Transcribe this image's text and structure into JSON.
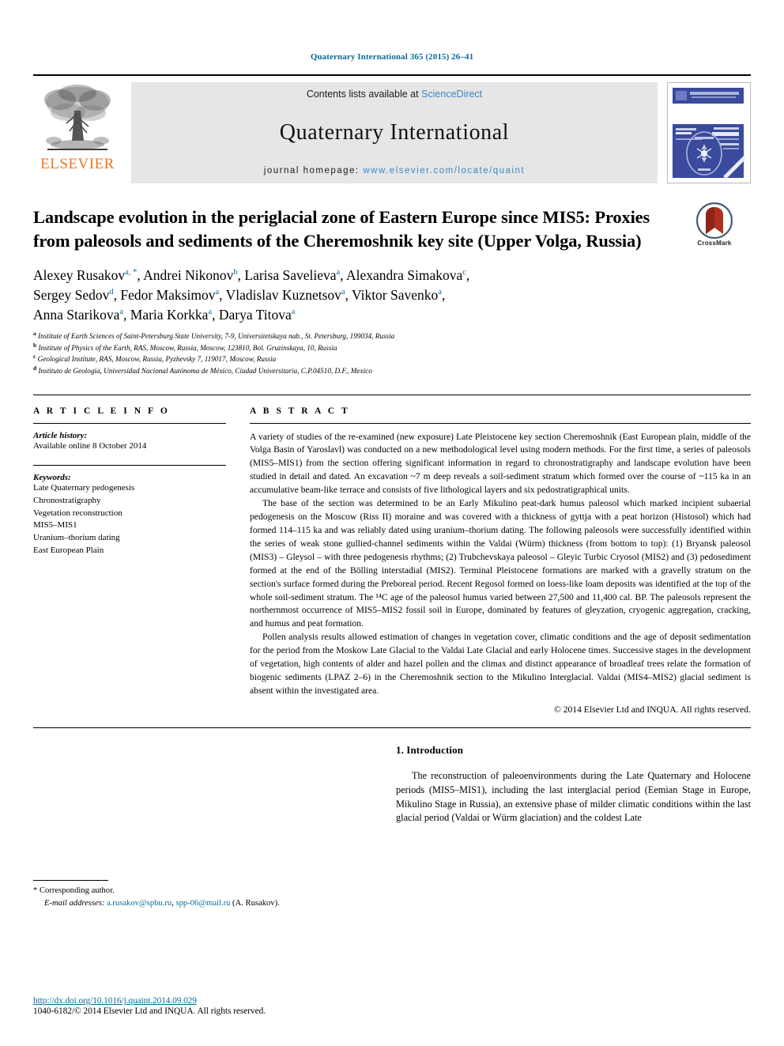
{
  "running_head": "Quaternary International 365 (2015) 26–41",
  "masthead": {
    "publisher_name": "ELSEVIER",
    "contents_prefix": "Contents lists available at ",
    "contents_link": "ScienceDirect",
    "journal_title": "Quaternary International",
    "homepage_prefix": "journal homepage: ",
    "homepage_url": "www.elsevier.com/locate/quaint",
    "cover_banner": "QUATERNARY INTERNATIONAL",
    "cover_subbanner": "The Journal of the International Union for Quaternary Research"
  },
  "article": {
    "title": "Landscape evolution in the periglacial zone of Eastern Europe since MIS5: Proxies from paleosols and sediments of the Cheremoshnik key site (Upper Volga, Russia)",
    "crossmark_label": "CrossMark",
    "authors_line_1": "Alexey Rusakov",
    "authors": [
      {
        "name": "Alexey Rusakov",
        "sup": "a, *"
      },
      {
        "name": "Andrei Nikonov",
        "sup": "b"
      },
      {
        "name": "Larisa Savelieva",
        "sup": "a"
      },
      {
        "name": "Alexandra Simakova",
        "sup": "c"
      },
      {
        "name": "Sergey Sedov",
        "sup": "d"
      },
      {
        "name": "Fedor Maksimov",
        "sup": "a"
      },
      {
        "name": "Vladislav Kuznetsov",
        "sup": "a"
      },
      {
        "name": "Viktor Savenko",
        "sup": "a"
      },
      {
        "name": "Anna Starikova",
        "sup": "a"
      },
      {
        "name": "Maria Korkka",
        "sup": "a"
      },
      {
        "name": "Darya Titova",
        "sup": "a"
      }
    ],
    "affiliations": [
      {
        "sup": "a",
        "text": "Institute of Earth Sciences of Saint-Petersburg State University, 7-9, Universitetskaya nab., St. Petersburg, 199034, Russia"
      },
      {
        "sup": "b",
        "text": "Institute of Physics of the Earth, RAS, Moscow, Russia, Moscow, 123810, Bol. Gruzinskaya, 10, Russia"
      },
      {
        "sup": "c",
        "text": "Geological Institute, RAS, Moscow, Russia, Pyzhevsky 7, 119017, Moscow, Russia"
      },
      {
        "sup": "d",
        "text": "Instituto de Geología, Universidad Nacional Autónoma de México, Ciudad Universitaria, C.P.04510, D.F., Mexico"
      }
    ]
  },
  "article_info": {
    "heading": "A R T I C L E  I N F O",
    "history_label": "Article history:",
    "history_value": "Available online 8 October 2014",
    "keywords_label": "Keywords:",
    "keywords": [
      "Late Quaternary pedogenesis",
      "Chronostratigraphy",
      "Vegetation reconstruction",
      "MIS5–MIS1",
      "Uranium–thorium dating",
      "East European Plain"
    ]
  },
  "abstract": {
    "heading": "A B S T R A C T",
    "paragraphs": [
      "A variety of studies of the re-examined (new exposure) Late Pleistocene key section Cheremoshnik (East European plain, middle of the Volga Basin of Yaroslavl) was conducted on a new methodological level using modern methods. For the first time, a series of paleosols (MIS5–MIS1) from the section offering significant information in regard to chronostratigraphy and landscape evolution have been studied in detail and dated. An excavation ~7 m deep reveals a soil-sediment stratum which formed over the course of ~115 ka in an accumulative beam-like terrace and consists of five lithological layers and six pedostratigraphical units.",
      "The base of the section was determined to be an Early Mikulino peat-dark humus paleosol which marked incipient subaerial pedogenesis on the Moscow (Riss II) moraine and was covered with a thickness of gyttja with a peat horizon (Histosol) which had formed 114–115 ka and was reliably dated using uranium–thorium dating. The following paleosols were successfully identified within the series of weak stone gullied-channel sediments within the Valdai (Würm) thickness (from bottom to top): (1) Bryansk paleosol (MIS3) – Gleysol – with three pedogenesis rhythms; (2) Trubchevskaya paleosol – Gleyic Turbic Cryosol (MIS2) and (3) pedosediment formed at the end of the Bölling interstadial (MIS2). Terminal Pleistocene formations are marked with a gravelly stratum on the section's surface formed during the Preboreal period. Recent Regosol formed on loess-like loam deposits was identified at the top of the whole soil-sediment stratum. The ¹⁴C age of the paleosol humus varied between 27,500 and 11,400 cal. BP. The paleosols represent the northernmost occurrence of MIS5–MIS2 fossil soil in Europe, dominated by features of gleyzation, cryogenic aggregation, cracking, and humus and peat formation.",
      "Pollen analysis results allowed estimation of changes in vegetation cover, climatic conditions and the age of deposit sedimentation for the period from the Moskow Late Glacial to the Valdai Late Glacial and early Holocene times. Successive stages in the development of vegetation, high contents of alder and hazel pollen and the climax and distinct appearance of broadleaf trees relate the formation of biogenic sediments (LPAZ 2–6) in the Cheremoshnik section to the Mikulino Interglacial. Valdai (MIS4–MIS2) glacial sediment is absent within the investigated area."
    ],
    "copyright": "© 2014 Elsevier Ltd and INQUA. All rights reserved."
  },
  "introduction": {
    "heading": "1.  Introduction",
    "paragraph": "The reconstruction of paleoenvironments during the Late Quaternary and Holocene periods (MIS5–MIS1), including the last interglacial period (Eemian Stage in Europe, Mikulino Stage in Russia), an extensive phase of milder climatic conditions within the last glacial period (Valdai or Würm glaciation) and the coldest Late"
  },
  "footnote": {
    "star": "*",
    "corresponding": "Corresponding author.",
    "email_label": "E-mail addresses:",
    "email_1": "a.rusakov@spbu.ru",
    "email_sep": ", ",
    "email_2": "spp-06@mail.ru",
    "email_attrib": " (A. Rusakov)."
  },
  "footer": {
    "doi": "http://dx.doi.org/10.1016/j.quaint.2014.09.029",
    "issn_line": "1040-6182/© 2014 Elsevier Ltd and INQUA. All rights reserved."
  }
}
